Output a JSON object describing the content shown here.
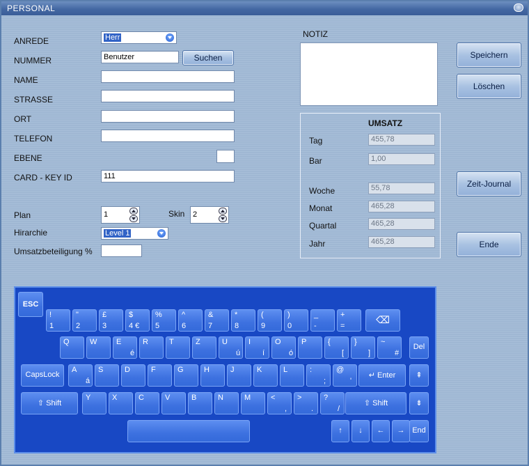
{
  "window": {
    "title": "PERSONAL"
  },
  "form": {
    "anrede": {
      "label": "ANREDE",
      "value": "Herr"
    },
    "nummer": {
      "label": "NUMMER",
      "value": "Benutzer",
      "search_label": "Suchen"
    },
    "name": {
      "label": "NAME",
      "value": ""
    },
    "strasse": {
      "label": "STRASSE",
      "value": ""
    },
    "ort": {
      "label": "ORT",
      "value": ""
    },
    "telefon": {
      "label": "TELEFON",
      "value": ""
    },
    "ebene": {
      "label": "EBENE",
      "value": ""
    },
    "card": {
      "label": "CARD - KEY ID",
      "value": "111"
    },
    "plan": {
      "label": "Plan",
      "value": "1"
    },
    "skin": {
      "label": "Skin",
      "value": "2"
    },
    "hirarchie": {
      "label": "Hirarchie",
      "value": "Level 1"
    },
    "umsatzbeteiligung": {
      "label": "Umsatzbeteiligung %",
      "value": ""
    }
  },
  "notiz": {
    "label": "NOTIZ"
  },
  "umsatz": {
    "title": "UMSATZ",
    "tag": {
      "label": "Tag",
      "value": "455,78"
    },
    "bar": {
      "label": "Bar",
      "value": "1,00"
    },
    "woche": {
      "label": "Woche",
      "value": "55,78"
    },
    "monat": {
      "label": "Monat",
      "value": "465,28"
    },
    "quartal": {
      "label": "Quartal",
      "value": "465,28"
    },
    "jahr": {
      "label": "Jahr",
      "value": "465,28"
    }
  },
  "buttons": {
    "speichern": "Speichern",
    "loeschen": "Löschen",
    "zeit_journal": "Zeit-Journal",
    "ende": "Ende"
  },
  "keyboard": {
    "esc": "ESC",
    "row1": [
      [
        "!",
        "1"
      ],
      [
        "\"",
        "2"
      ],
      [
        "£",
        "3"
      ],
      [
        "$",
        "4 €"
      ],
      [
        "%",
        "5"
      ],
      [
        "^",
        "6"
      ],
      [
        "&",
        "7"
      ],
      [
        "*",
        "8"
      ],
      [
        "(",
        "9"
      ],
      [
        ")",
        "0"
      ],
      [
        "_",
        "-"
      ],
      [
        "+",
        "="
      ]
    ],
    "row2": [
      [
        "Q",
        ""
      ],
      [
        "W",
        ""
      ],
      [
        "E",
        "é"
      ],
      [
        "R",
        ""
      ],
      [
        "T",
        ""
      ],
      [
        "Z",
        ""
      ],
      [
        "U",
        "ú"
      ],
      [
        "I",
        "í"
      ],
      [
        "O",
        "ó"
      ],
      [
        "P",
        ""
      ],
      [
        "{",
        "["
      ],
      [
        "}",
        "]"
      ],
      [
        "~",
        "#"
      ]
    ],
    "row3": [
      [
        "A",
        "á"
      ],
      [
        "S",
        ""
      ],
      [
        "D",
        ""
      ],
      [
        "F",
        ""
      ],
      [
        "G",
        ""
      ],
      [
        "H",
        ""
      ],
      [
        "J",
        ""
      ],
      [
        "K",
        ""
      ],
      [
        "L",
        ""
      ],
      [
        ":",
        ";"
      ],
      [
        "@",
        "'"
      ]
    ],
    "row4": [
      [
        "Y",
        ""
      ],
      [
        "X",
        ""
      ],
      [
        "C",
        ""
      ],
      [
        "V",
        ""
      ],
      [
        "B",
        ""
      ],
      [
        "N",
        ""
      ],
      [
        "M",
        ""
      ],
      [
        "<",
        ","
      ],
      [
        ">",
        "."
      ],
      [
        "?",
        "/"
      ]
    ],
    "del": "Del",
    "capslock": "CapsLock",
    "enter": "↵ Enter",
    "shift": "⇧  Shift",
    "end": "End",
    "arrows": [
      "↑",
      "↓",
      "←",
      "→"
    ]
  }
}
